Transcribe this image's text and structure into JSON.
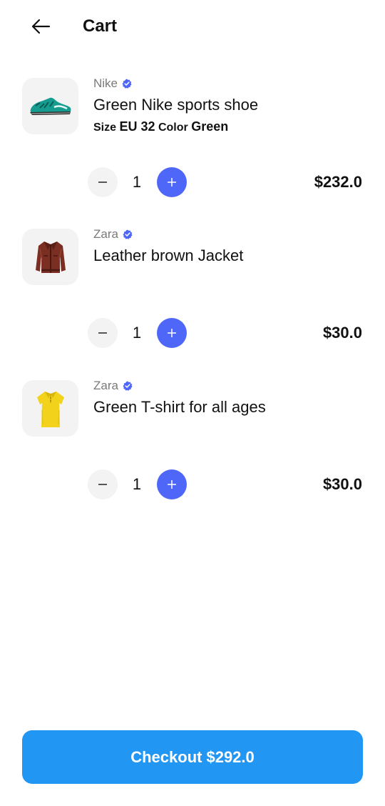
{
  "header": {
    "title": "Cart",
    "back_icon": "arrow-left-icon"
  },
  "items": [
    {
      "brand": "Nike",
      "verified_icon": "verified-badge-icon",
      "name": "Green Nike sports shoe",
      "size_label": "Size",
      "size_value": "EU 32",
      "color_label": "Color",
      "color_value": "Green",
      "quantity": "1",
      "price": "$232.0",
      "image_icon": "sneaker-image"
    },
    {
      "brand": "Zara",
      "verified_icon": "verified-badge-icon",
      "name": "Leather brown Jacket",
      "quantity": "1",
      "price": "$30.0",
      "image_icon": "leather-jacket-image"
    },
    {
      "brand": "Zara",
      "verified_icon": "verified-badge-icon",
      "name": "Green T-shirt for all ages",
      "quantity": "1",
      "price": "$30.0",
      "image_icon": "yellow-polo-shirt-image"
    }
  ],
  "checkout": {
    "label": "Checkout",
    "total": "$292.0"
  },
  "colors": {
    "accent": "#4f67f8",
    "checkout": "#2196f3",
    "thumb_bg": "#f3f3f3",
    "verified": "#4f67f8"
  }
}
